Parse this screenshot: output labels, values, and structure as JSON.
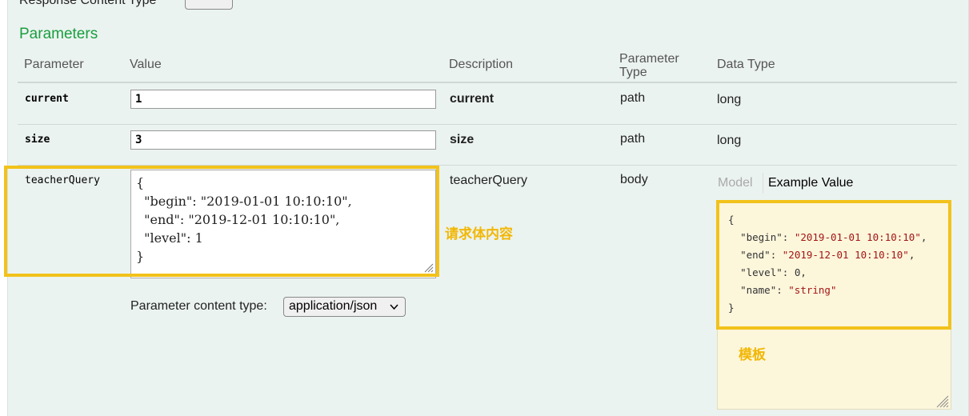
{
  "response_content_type": {
    "label": "Response Content Type"
  },
  "section_title": "Parameters",
  "headers": {
    "parameter": "Parameter",
    "value": "Value",
    "description": "Description",
    "parameter_type_line1": "Parameter",
    "parameter_type_line2": "Type",
    "data_type": "Data Type"
  },
  "rows": [
    {
      "name": "current",
      "value": "1",
      "description": "current",
      "param_type": "path",
      "data_type": "long"
    },
    {
      "name": "size",
      "value": "3",
      "description": "size",
      "param_type": "path",
      "data_type": "long"
    },
    {
      "name": "teacherQuery",
      "description": "teacherQuery",
      "param_type": "body",
      "body_value": "{\n  \"begin\": \"2019-01-01 10:10:10\",\n  \"end\": \"2019-12-01 10:10:10\",\n  \"level\": 1\n}"
    }
  ],
  "content_type": {
    "label": "Parameter content type:",
    "selected": "application/json"
  },
  "tabs": {
    "model": "Model",
    "example": "Example Value"
  },
  "example": {
    "open": "{",
    "begin_key": "\"begin\"",
    "begin_val": "\"2019-01-01 10:10:10\"",
    "end_key": "\"end\"",
    "end_val": "\"2019-12-01 10:10:10\"",
    "level_key": "\"level\"",
    "level_val": "0",
    "name_key": "\"name\"",
    "name_val": "\"string\"",
    "close": "}"
  },
  "annotations": {
    "request_body": "请求体内容",
    "template": "模板"
  },
  "colors": {
    "section_green": "#1a9e3f",
    "highlight_yellow": "#f2c21b",
    "panel_bg": "#ebf3f0",
    "example_bg": "#fcf6db",
    "string_red": "#a31515"
  }
}
